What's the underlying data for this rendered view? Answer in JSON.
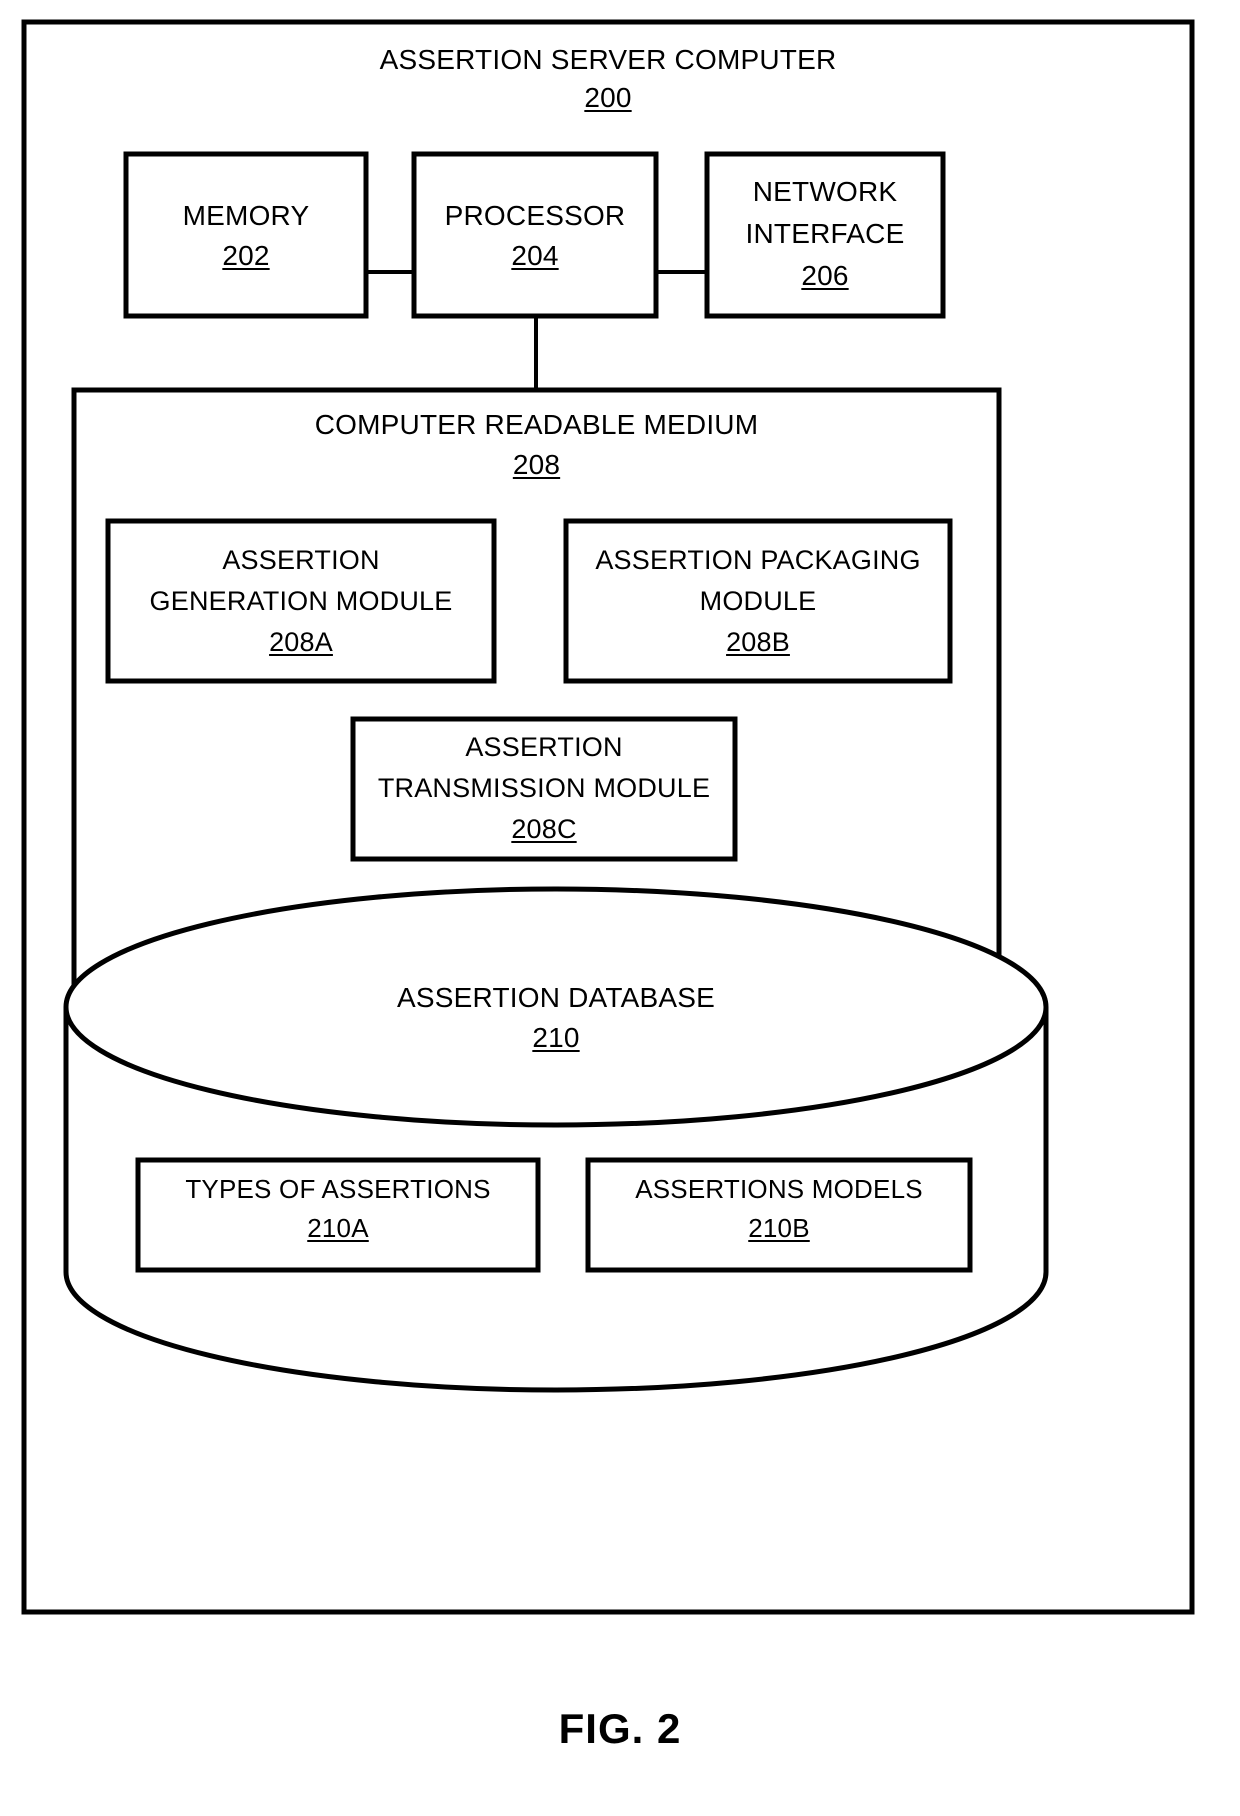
{
  "figure": {
    "caption": "FIG. 2",
    "outer_box": {
      "title": "ASSERTION SERVER COMPUTER",
      "ref": "200"
    }
  },
  "hardware_row": [
    {
      "name": "memory",
      "label": "MEMORY",
      "ref": "202"
    },
    {
      "name": "processor",
      "label": "PROCESSOR",
      "ref": "204"
    },
    {
      "name": "network-interface",
      "label_line1": "NETWORK",
      "label_line2": "INTERFACE",
      "ref": "206"
    }
  ],
  "computer_readable_medium": {
    "title": "COMPUTER READABLE MEDIUM",
    "ref": "208",
    "modules": [
      {
        "name": "assertion-generation-module",
        "line1": "ASSERTION",
        "line2": "GENERATION MODULE",
        "ref": "208A"
      },
      {
        "name": "assertion-packaging-module",
        "line1": "ASSERTION PACKAGING",
        "line2": "MODULE",
        "ref": "208B"
      },
      {
        "name": "assertion-transmission-module",
        "line1": "ASSERTION",
        "line2": "TRANSMISSION MODULE",
        "ref": "208C"
      }
    ]
  },
  "assertion_database": {
    "title": "ASSERTION DATABASE",
    "ref": "210",
    "stores": [
      {
        "name": "types-of-assertions",
        "label": "TYPES OF ASSERTIONS",
        "ref": "210A"
      },
      {
        "name": "assertions-models",
        "label": "ASSERTIONS MODELS",
        "ref": "210B"
      }
    ]
  },
  "style": {
    "line_color": "#000000",
    "background": "#ffffff"
  }
}
